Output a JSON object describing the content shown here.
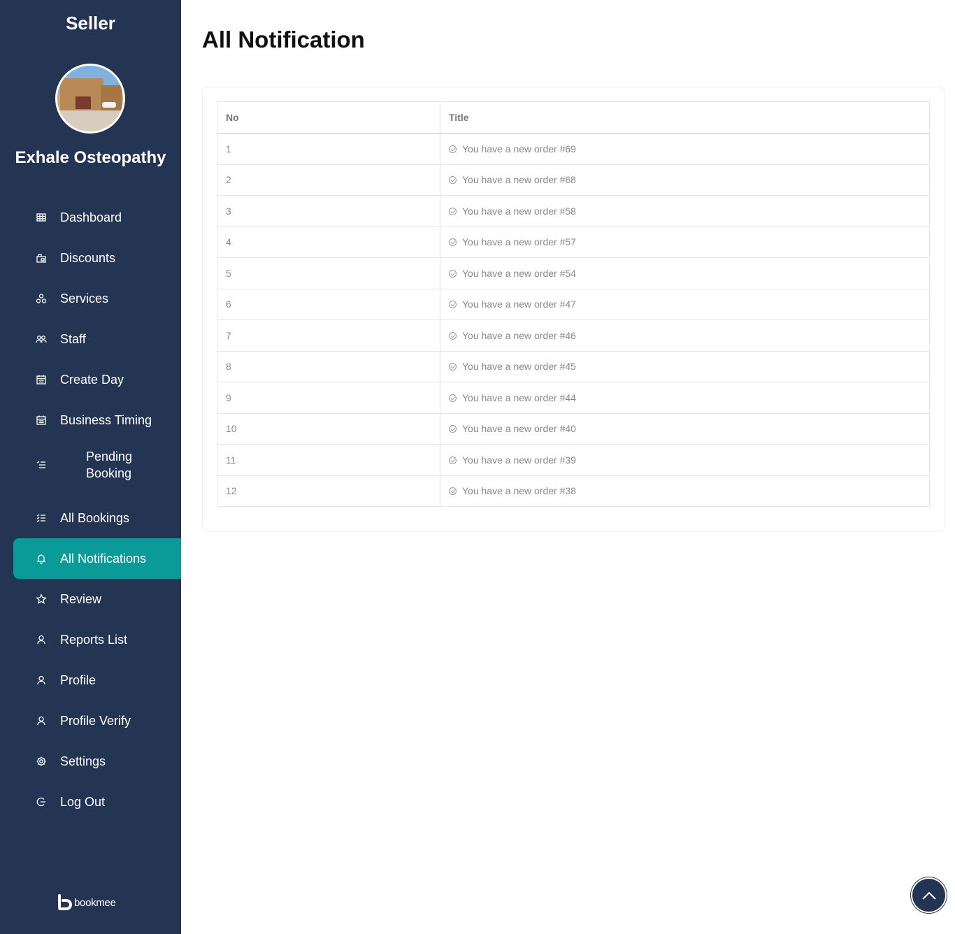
{
  "sidebar": {
    "title": "Seller",
    "business_name": "Exhale Osteopathy",
    "items": [
      {
        "label": "Dashboard",
        "icon": "grid-icon"
      },
      {
        "label": "Discounts",
        "icon": "shop-icon"
      },
      {
        "label": "Services",
        "icon": "services-icon"
      },
      {
        "label": "Staff",
        "icon": "users-icon"
      },
      {
        "label": "Create Day",
        "icon": "calendar-icon"
      },
      {
        "label": "Business Timing",
        "icon": "calendar-icon"
      },
      {
        "label": "Pending Booking",
        "icon": "list-icon"
      },
      {
        "label": "All Bookings",
        "icon": "checklist-icon"
      },
      {
        "label": "All Notifications",
        "icon": "bell-icon",
        "active": true
      },
      {
        "label": "Review",
        "icon": "star-icon"
      },
      {
        "label": "Reports List",
        "icon": "user-icon"
      },
      {
        "label": "Profile",
        "icon": "user-icon"
      },
      {
        "label": "Profile Verify",
        "icon": "user-icon"
      },
      {
        "label": "Settings",
        "icon": "gear-icon"
      },
      {
        "label": "Log Out",
        "icon": "logout-icon"
      }
    ],
    "brand": "bookmee"
  },
  "main": {
    "title": "All Notification",
    "table": {
      "headers": [
        "No",
        "Title"
      ],
      "rows": [
        {
          "no": "1",
          "title": "You have a new order #69"
        },
        {
          "no": "2",
          "title": "You have a new order #68"
        },
        {
          "no": "3",
          "title": "You have a new order #58"
        },
        {
          "no": "4",
          "title": "You have a new order #57"
        },
        {
          "no": "5",
          "title": "You have a new order #54"
        },
        {
          "no": "6",
          "title": "You have a new order #47"
        },
        {
          "no": "7",
          "title": "You have a new order #46"
        },
        {
          "no": "8",
          "title": "You have a new order #45"
        },
        {
          "no": "9",
          "title": "You have a new order #44"
        },
        {
          "no": "10",
          "title": "You have a new order #40"
        },
        {
          "no": "11",
          "title": "You have a new order #39"
        },
        {
          "no": "12",
          "title": "You have a new order #38"
        }
      ]
    }
  },
  "colors": {
    "sidebar_bg": "#233553",
    "active_bg": "#0a9a98"
  }
}
